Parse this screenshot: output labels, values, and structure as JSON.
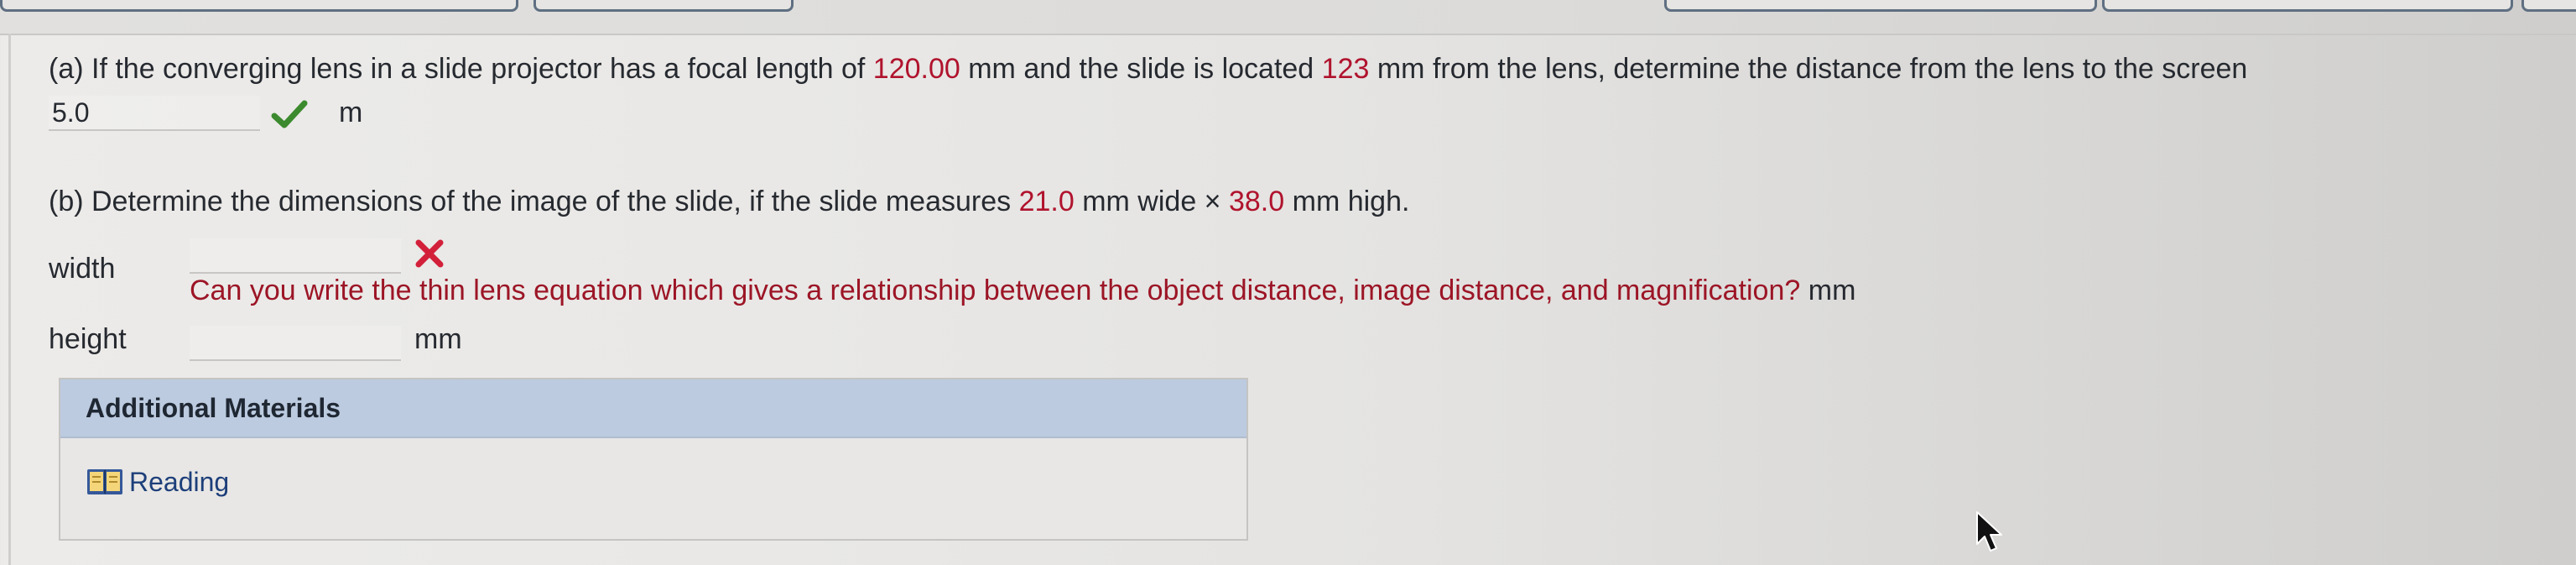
{
  "part_a": {
    "question_prefix": "(a) If the converging lens in a slide projector has a focal length of ",
    "focal_length": "120.00",
    "question_mid": " mm and the slide is located ",
    "object_distance": "123",
    "question_suffix": " mm from the lens, determine the distance from the lens to the screen",
    "answer_value": "5.0",
    "answer_unit": "m",
    "status": "correct"
  },
  "part_b": {
    "question_prefix": "(b) Determine the dimensions of the image of the slide, if the slide measures ",
    "slide_width": "21.0",
    "question_mid": " mm wide × ",
    "slide_height": "38.0",
    "question_suffix": " mm high.",
    "width_label": "width",
    "width_value": "",
    "width_status": "incorrect",
    "feedback": "Can you write the thin lens equation which gives a relationship between the object distance, image distance, and magnification?",
    "feedback_unit": "mm",
    "height_label": "height",
    "height_value": "",
    "height_unit": "mm"
  },
  "additional_materials": {
    "header": "Additional Materials",
    "items": [
      {
        "label": "Reading",
        "icon": "book-icon"
      }
    ]
  },
  "colors": {
    "accent_red": "#b0132d",
    "check_green": "#3c8a2e",
    "panel_header": "#bccbe0",
    "link_blue": "#1d3f7a"
  }
}
